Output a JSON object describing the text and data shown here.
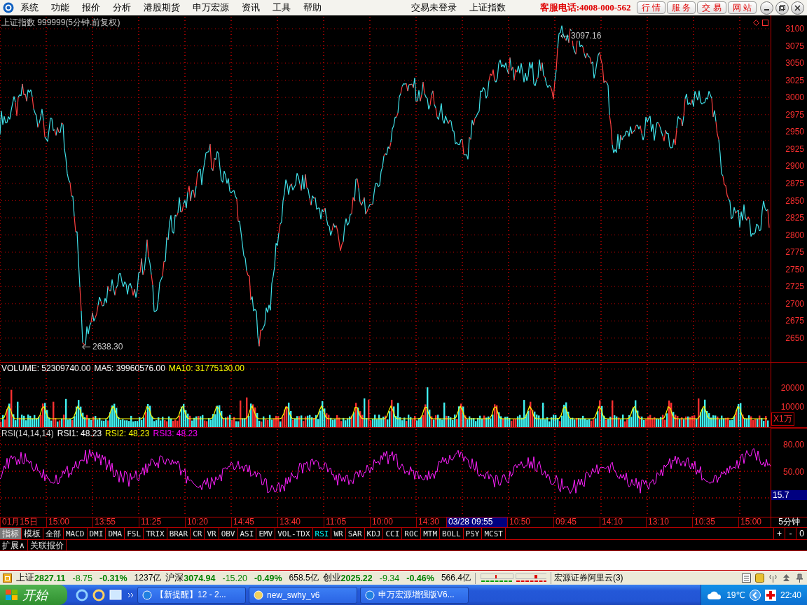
{
  "menu": {
    "items": [
      "系统",
      "功能",
      "报价",
      "分析",
      "港股期货",
      "申万宏源",
      "资讯",
      "工具",
      "帮助"
    ],
    "center": [
      "交易未登录",
      "上证指数"
    ],
    "hotline": "客服电话:4008-000-562",
    "buttons": [
      "行 情",
      "服 务",
      "交 易",
      "网 站"
    ]
  },
  "price_panel": {
    "title": "上证指数 999999(5分钟.前复权)",
    "axis": [
      "3100",
      "3075",
      "3050",
      "3025",
      "3000",
      "2975",
      "2950",
      "2925",
      "2900",
      "2875",
      "2850",
      "2825",
      "2800",
      "2775",
      "2750",
      "2725",
      "2700",
      "2675",
      "2650"
    ],
    "high_label": "3097.16",
    "low_label": "2638.30"
  },
  "volume_panel": {
    "legend": [
      {
        "text": "VOLUME: 52309740.00",
        "color": "#ffffff"
      },
      {
        "text": "MA5: 39960576.00",
        "color": "#ffffff"
      },
      {
        "text": "MA10: 31775130.00",
        "color": "#ffff00"
      }
    ],
    "axis": [
      "20000",
      "10000"
    ],
    "unit": "X1万"
  },
  "rsi_panel": {
    "legend": [
      {
        "text": "RSI(14,14,14)",
        "color": "#d0d0d0"
      },
      {
        "text": "RSI1: 48.23",
        "color": "#ffffff"
      },
      {
        "text": "RSI2: 48.23",
        "color": "#ffff00"
      },
      {
        "text": "RSI3: 48.23",
        "color": "#ff00ff"
      }
    ],
    "axis": [
      "80.00",
      "50.00"
    ],
    "current": "15.7"
  },
  "time_axis": {
    "labels": [
      {
        "text": "01月15日",
        "selected": false
      },
      {
        "text": "15:00",
        "selected": false
      },
      {
        "text": "13:55",
        "selected": false
      },
      {
        "text": "11:25",
        "selected": false
      },
      {
        "text": "10:20",
        "selected": false
      },
      {
        "text": "14:45",
        "selected": false
      },
      {
        "text": "13:40",
        "selected": false
      },
      {
        "text": "11:05",
        "selected": false
      },
      {
        "text": "10:00",
        "selected": false
      },
      {
        "text": "14:30",
        "selected": false
      },
      {
        "text": "03/28 09:55",
        "selected": true
      },
      {
        "text": "10:50",
        "selected": false
      },
      {
        "text": "09:45",
        "selected": false
      },
      {
        "text": "14:10",
        "selected": false
      },
      {
        "text": "13:10",
        "selected": false
      },
      {
        "text": "10:35",
        "selected": false
      },
      {
        "text": "15:00",
        "selected": false
      }
    ],
    "period": "5分钟"
  },
  "mode_tabs": [
    {
      "label": "指标",
      "selected": true
    },
    {
      "label": "模板",
      "selected": false
    }
  ],
  "indicator_tabs": [
    {
      "label": "全部",
      "selected": false
    },
    {
      "label": "MACD",
      "selected": false
    },
    {
      "label": "DMI",
      "selected": false
    },
    {
      "label": "DMA",
      "selected": false
    },
    {
      "label": "FSL",
      "selected": false
    },
    {
      "label": "TRIX",
      "selected": false
    },
    {
      "label": "BRAR",
      "selected": false
    },
    {
      "label": "CR",
      "selected": false
    },
    {
      "label": "VR",
      "selected": false
    },
    {
      "label": "OBV",
      "selected": false
    },
    {
      "label": "ASI",
      "selected": false
    },
    {
      "label": "EMV",
      "selected": false
    },
    {
      "label": "VOL-TDX",
      "selected": false
    },
    {
      "label": "RSI",
      "selected": true
    },
    {
      "label": "WR",
      "selected": false
    },
    {
      "label": "SAR",
      "selected": false
    },
    {
      "label": "KDJ",
      "selected": false
    },
    {
      "label": "CCI",
      "selected": false
    },
    {
      "label": "ROC",
      "selected": false
    },
    {
      "label": "MTM",
      "selected": false
    },
    {
      "label": "BOLL",
      "selected": false
    },
    {
      "label": "PSY",
      "selected": false
    },
    {
      "label": "MCST",
      "selected": false
    }
  ],
  "zoom_buttons": [
    "+",
    "-",
    "0"
  ],
  "bottom_tabs": [
    "扩展∧",
    "关联报价"
  ],
  "status_bar": {
    "markets": [
      {
        "name": "上证",
        "value": "2827.11",
        "change": "-8.75",
        "pct": "-0.31%",
        "amount": "1237亿"
      },
      {
        "name": "沪深",
        "value": "3074.94",
        "change": "-15.20",
        "pct": "-0.49%",
        "amount": "658.5亿"
      },
      {
        "name": "创业",
        "value": "2025.22",
        "change": "-9.34",
        "pct": "-0.46%",
        "amount": "566.4亿"
      }
    ],
    "server": "宏源证券阿里云(3)"
  },
  "taskbar": {
    "start": "开始",
    "tasks": [
      "【新提醒】12 - 2...",
      "new_swhy_v6",
      "申万宏源增强版V6..."
    ],
    "temperature": "19℃",
    "clock": "22:40"
  }
}
